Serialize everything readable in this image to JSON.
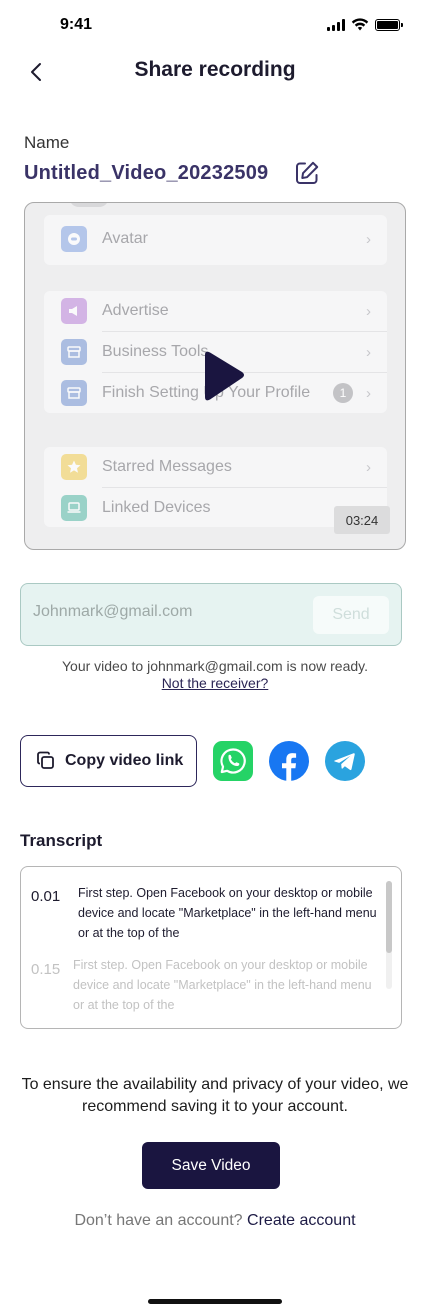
{
  "status": {
    "time": "9:41"
  },
  "header": {
    "title": "Share recording"
  },
  "name": {
    "label": "Name",
    "value": "Untitled_Video_20232509"
  },
  "video": {
    "rows_group1": [
      {
        "label": "Avatar",
        "icon": "avatar-icon",
        "color": "#7f9fe0"
      }
    ],
    "rows_group2": [
      {
        "label": "Advertise",
        "icon": "megaphone-icon",
        "color": "#b77fd8"
      },
      {
        "label": "Business Tools",
        "icon": "store-icon",
        "color": "#6f8fd0"
      },
      {
        "label": "Finish Setting Up Your Profile",
        "icon": "store-icon",
        "color": "#6f8fd0",
        "badge": "1"
      }
    ],
    "rows_group3": [
      {
        "label": "Starred Messages",
        "icon": "star-icon",
        "color": "#f0c94a"
      },
      {
        "label": "Linked Devices",
        "icon": "laptop-icon",
        "color": "#4fb6a3"
      }
    ],
    "duration": "03:24"
  },
  "email": {
    "placeholder": "Johnmark@gmail.com",
    "send_label": "Send"
  },
  "ready": {
    "message": "Your video to johnmark@gmail.com is now ready.",
    "not_receiver": "Not the receiver?"
  },
  "share": {
    "copy_label": "Copy video link",
    "whatsapp_color": "#25d366",
    "facebook_color": "#1877f2",
    "telegram_color": "#2aa3df"
  },
  "transcript": {
    "title": "Transcript",
    "entries": [
      {
        "time": "0.01",
        "text": "First step. Open Facebook on your desktop or mobile device and locate \"Marketplace\" in the left-hand menu or at the top of the"
      },
      {
        "time": "0.15",
        "text": "First step. Open Facebook on your desktop or mobile device and locate \"Marketplace\" in the left-hand menu or at the top of the"
      }
    ]
  },
  "save": {
    "note": "To ensure the availability and privacy of your video, we recommend saving it to your account.",
    "button": "Save Video",
    "account_prompt": "Don’t have an account?",
    "create_account": "Create account"
  },
  "colors": {
    "brand_dark": "#1a1540",
    "title_purple": "#3a3367",
    "email_bg": "#e6f3f1"
  }
}
